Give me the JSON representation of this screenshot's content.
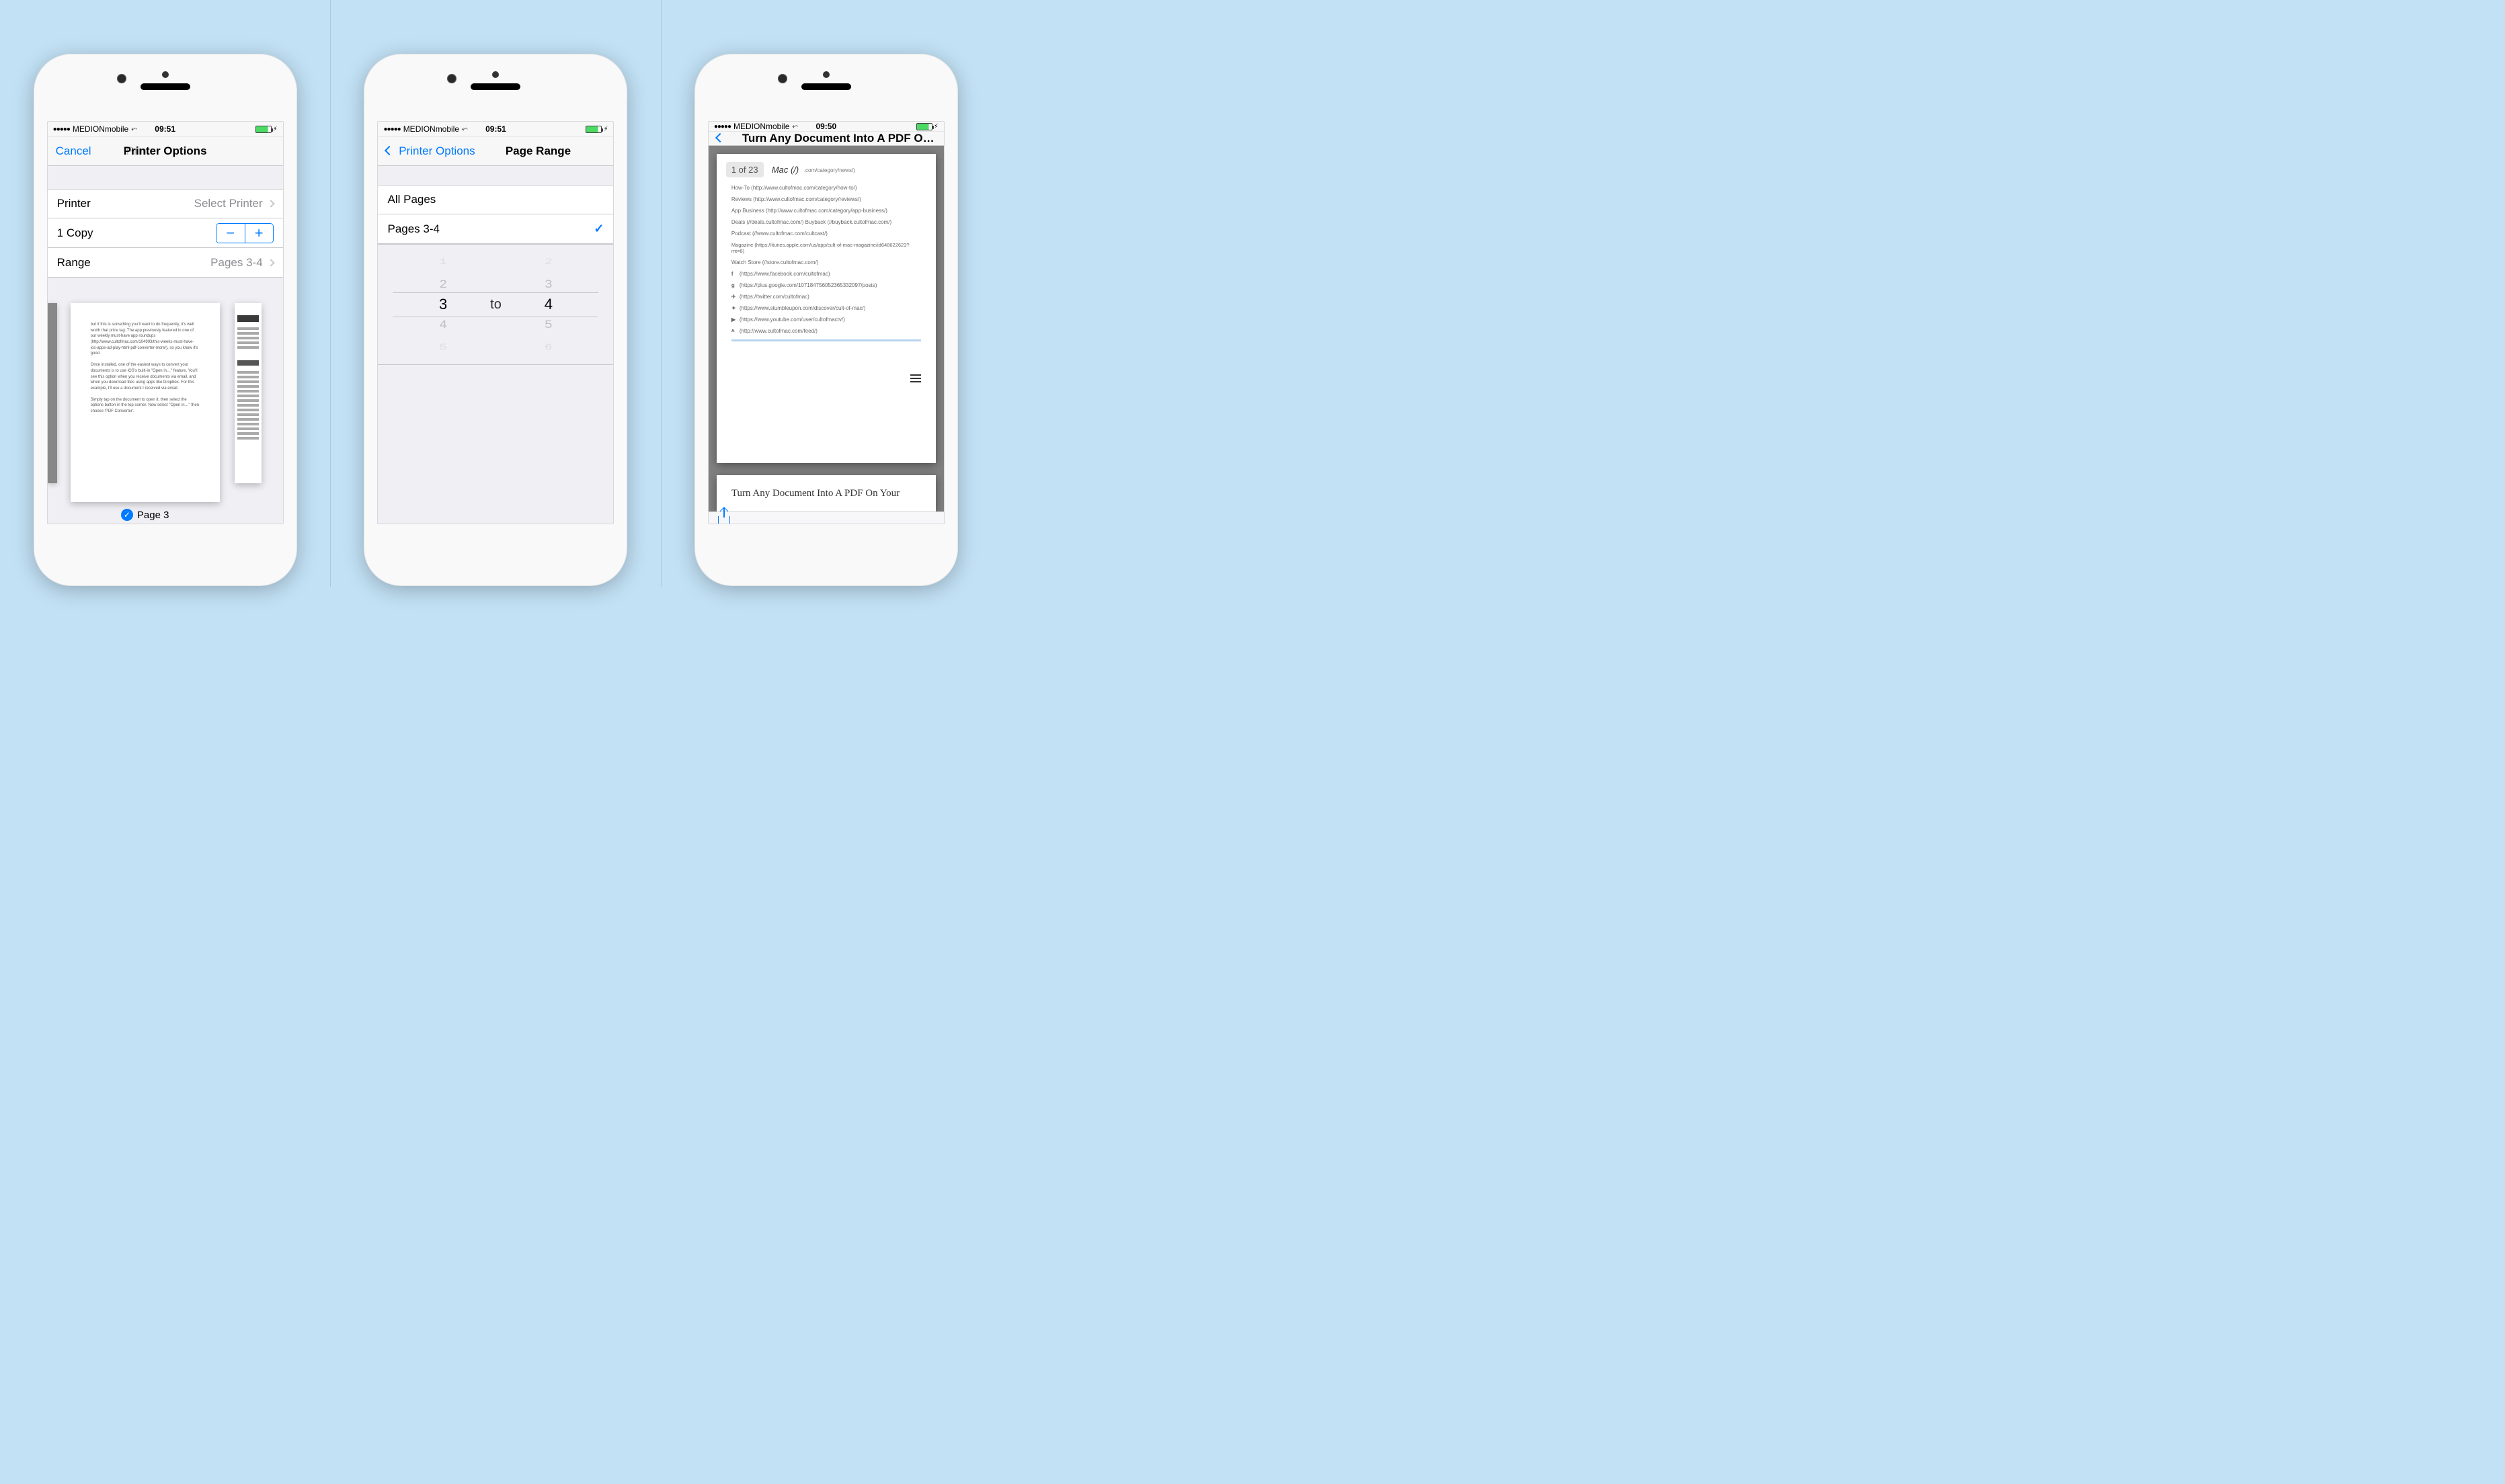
{
  "status": {
    "carrier": "MEDIONmobile",
    "time1": "09:51",
    "time2": "09:51",
    "time3": "09:50"
  },
  "screen1": {
    "cancel": "Cancel",
    "title": "Printer Options",
    "print": "Print",
    "printer_label": "Printer",
    "printer_value": "Select Printer",
    "copies_label": "1 Copy",
    "range_label": "Range",
    "range_value": "Pages 3-4",
    "preview_text": {
      "p1": "but if this is something you'll want to do frequently, it's well worth that price tag. The app previously featured in one of our weekly must-have app roundups (http://www.cultofmac.com/104993/this-weeks-must-have-ios-apps-ad-play-html-pdf-converter-more/), so you know it's good.",
      "p2": "Once installed, one of the easiest ways to convert your documents is to use iOS's built-in \"Open in…\" feature. You'll see this option when you receive documents via email, and when you download files using apps like Dropbox. For this example, I'll use a document I received via email.",
      "p3": "Simply tap on the document to open it, then select the options button in the top corner. Now select \"Open in…\" then choose 'PDF Converter'."
    },
    "page_label": "Page 3"
  },
  "screen2": {
    "back": "Printer Options",
    "title": "Page Range",
    "all_pages": "All Pages",
    "selected_range": "Pages 3-4",
    "picker_to": "to",
    "wheel1": [
      "1",
      "2",
      "3",
      "4",
      "5"
    ],
    "wheel2": [
      "2",
      "3",
      "4",
      "5",
      "6"
    ],
    "wheel1_selected": "3",
    "wheel2_selected": "4"
  },
  "screen3": {
    "title": "Turn Any Document Into A PDF On Y…",
    "page_badge": "1 of 23",
    "header_frag": "Mac (/)",
    "header_url_frag": ".com/category/news/)",
    "links": [
      "How-To (http://www.cultofmac.com/category/how-to/)",
      "Reviews (http://www.cultofmac.com/category/reviews/)",
      "App Business (http://www.cultofmac.com/category/app-business/)",
      "Deals (//deals.cultofmac.com/)    Buyback (//buyback.cultofmac.com/)",
      "Podcast (//www.cultofmac.com/cultcast/)",
      "Magazine (https://itunes.apple.com/us/app/cult-of-mac-magazine/id648622623?mt=8)",
      "Watch Store (//store.cultofmac.com/)"
    ],
    "social": [
      {
        "ico": "f",
        "text": "(https://www.facebook.com/cultofmac)"
      },
      {
        "ico": "g",
        "text": "(https://plus.google.com/107184756052365332097/posts)"
      },
      {
        "ico": "✈",
        "text": "(https://twitter.com/cultofmac)"
      },
      {
        "ico": "✦",
        "text": "(https://www.stumbleupon.com/discover/cult-of-mac/)"
      },
      {
        "ico": "▶",
        "text": "(https://www.youtube.com/user/cultofmactv/)"
      },
      {
        "ico": "እ",
        "text": "(http://www.cultofmac.com/feed/)"
      }
    ],
    "article_title": "Turn Any Document Into A PDF On Your"
  }
}
